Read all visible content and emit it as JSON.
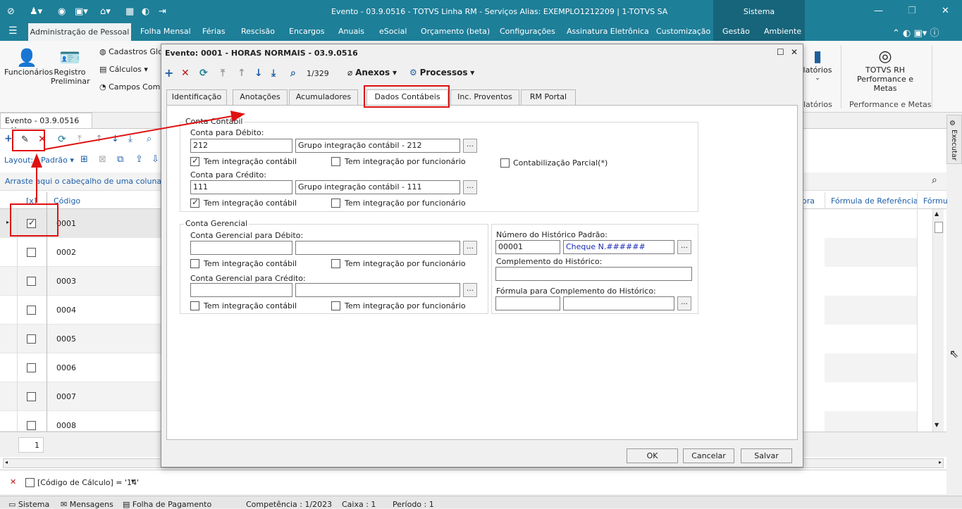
{
  "window": {
    "title": "Evento - 03.9.0516 - TOTVS Linha RM - Serviços  Alias: EXEMPLO1212209 | 1-TOTVS SA",
    "sistema": "Sistema"
  },
  "menu": {
    "items": [
      "Administração de Pessoal",
      "Folha Mensal",
      "Férias",
      "Rescisão",
      "Encargos",
      "Anuais",
      "eSocial",
      "Orçamento (beta)",
      "Configurações",
      "Assinatura Eletrônica",
      "Customização",
      "Gestão",
      "Ambiente"
    ]
  },
  "ribbon": {
    "funcionarios": "Funcionários",
    "registro": "Registro",
    "preliminar": "Preliminar",
    "cadastros": "Cadastros Glo",
    "calculos": "Cálculos",
    "campos": "Campos Comp",
    "relatorios": "latórios",
    "relatorios2": "latórios",
    "totvs_rh": "TOTVS RH",
    "perf_metas": "Performance e Metas",
    "perf_metas_group": "Performance e Metas",
    "executar": "Executar"
  },
  "doc": {
    "tab_label": "Evento - 03.9.0516",
    "layout_label": "Layout:",
    "layout_value": "Padrão",
    "group_hint": "Arraste aqui o cabeçalho de uma coluna para",
    "col_check": "[x]",
    "col_codigo": "Código",
    "col_ora": "ora",
    "col_formula": "Fórmula de Referência",
    "col_form2": "Fórmu",
    "rows": [
      "0001",
      "0002",
      "0003",
      "0004",
      "0005",
      "0006",
      "0007",
      "0008"
    ],
    "page": "1",
    "filter": "[Código de Cálculo] = '14'"
  },
  "dialog": {
    "title": "Evento: 0001 - HORAS NORMAIS - 03.9.0516",
    "record_nav": "1/329",
    "anexos": "Anexos",
    "processos": "Processos",
    "tabs": [
      "Identificação",
      "Anotações",
      "Acumuladores",
      "Dados Contábeis",
      "Inc. Proventos",
      "RM Portal"
    ],
    "conta_contabil": {
      "group": "Conta Contábil",
      "debito_label": "Conta para Débito:",
      "debito_code": "212",
      "debito_desc": "Grupo integração contábil - 212",
      "credito_label": "Conta para Crédito:",
      "credito_code": "111",
      "credito_desc": "Grupo integração contábil - 111",
      "tem_integracao": "Tem integração contábil",
      "tem_integracao_func": "Tem integração por funcionário",
      "contab_parcial": "Contabilização Parcial(*)"
    },
    "conta_gerencial": {
      "group": "Conta Gerencial",
      "debito_label": "Conta Gerencial para Débito:",
      "credito_label": "Conta Gerencial para Crédito:",
      "tem_integracao": "Tem integração contábil",
      "tem_integracao_func": "Tem integração por funcionário"
    },
    "historico": {
      "numero_label": "Número do Histórico Padrão:",
      "numero_value": "00001",
      "numero_desc": "Cheque N.######",
      "complemento_label": "Complemento do Histórico:",
      "formula_label": "Fórmula para Complemento do Histórico:"
    },
    "ok": "OK",
    "cancelar": "Cancelar",
    "salvar": "Salvar"
  },
  "status": {
    "sistema": "Sistema",
    "mensagens": "Mensagens",
    "folha": "Folha de Pagamento",
    "competencia": "Competência : 1/2023",
    "caixa": "Caixa : 1",
    "periodo": "Período : 1"
  },
  "colors": {
    "titlebar": "#1e7f99",
    "annotation": "#e01010",
    "link_blue": "#1a2bb3"
  }
}
